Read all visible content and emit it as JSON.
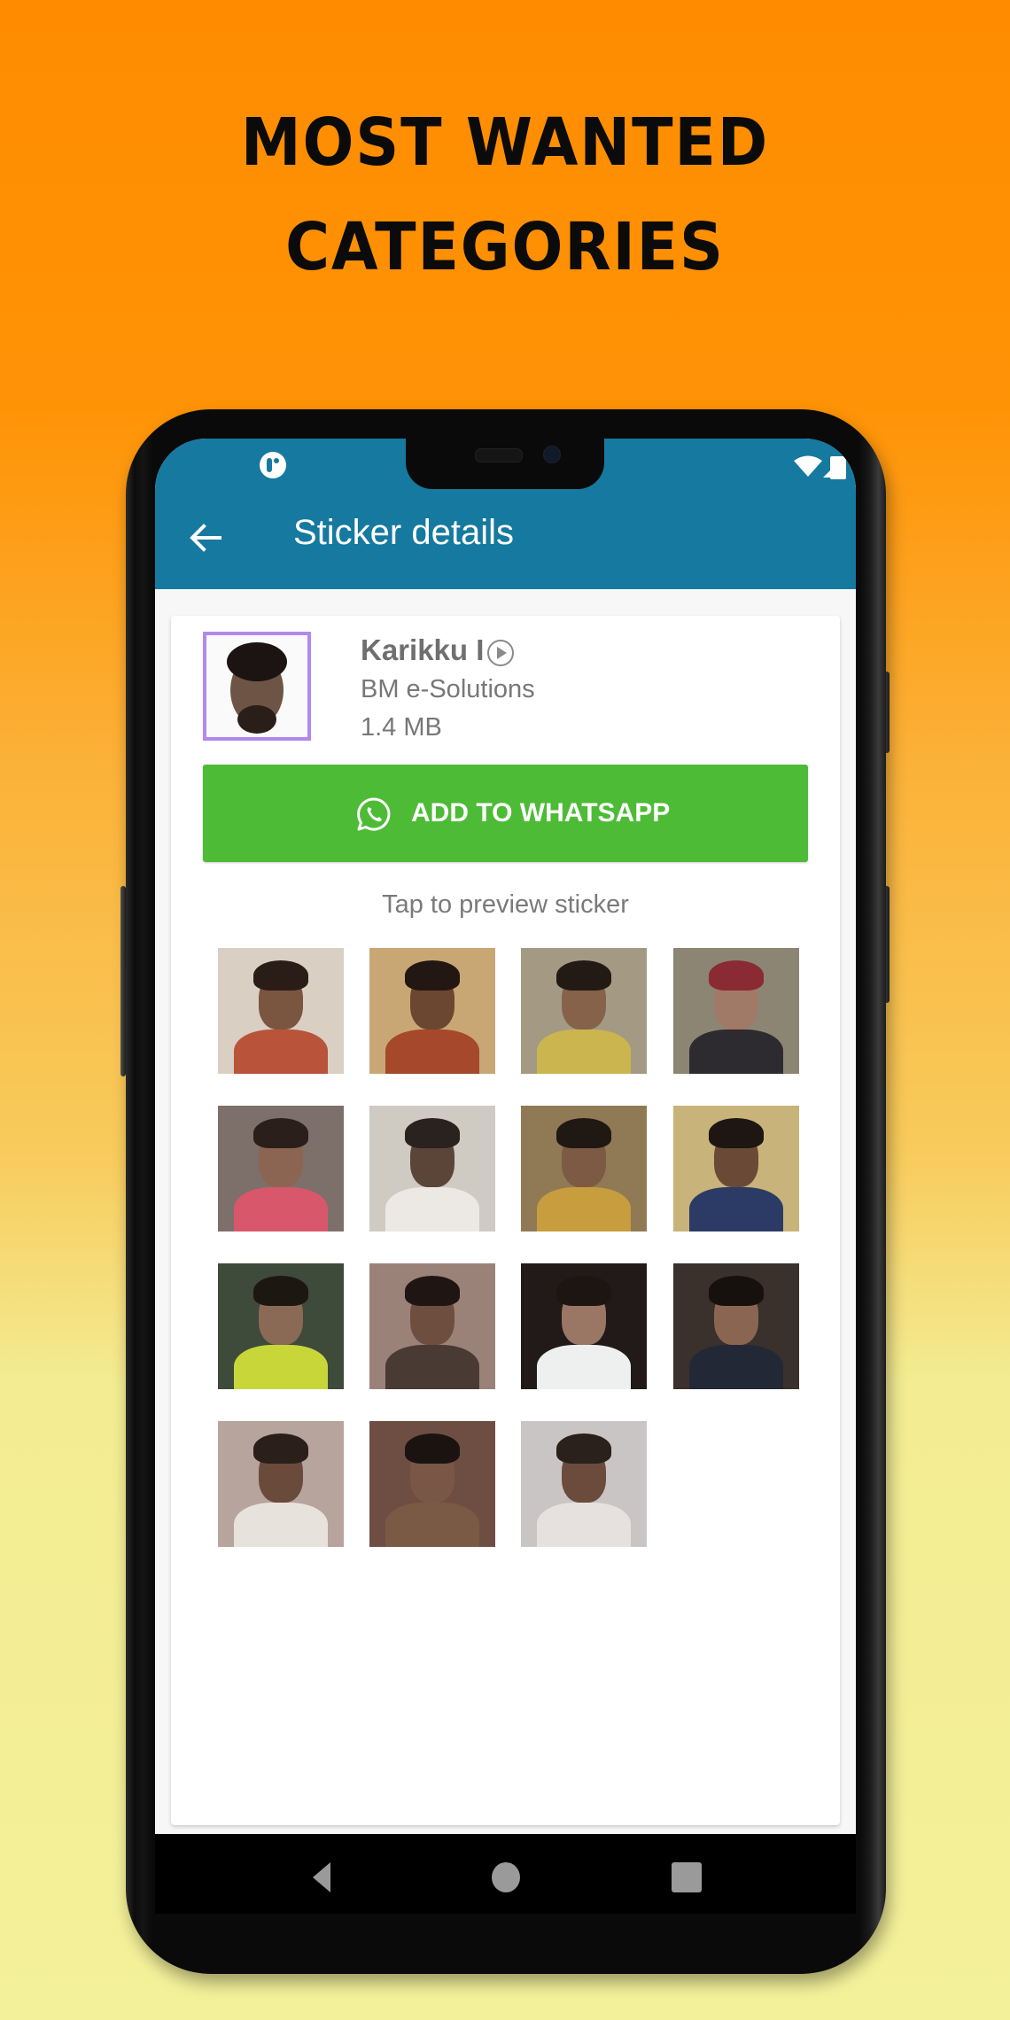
{
  "promo": {
    "headline_line1": "MOST WANTED",
    "headline_line2": "CATEGORIES",
    "background_top_color": "#FF8C00",
    "background_bottom_color": "#F3F19A"
  },
  "status_bar": {
    "left_icons": [
      "app-notification-icon"
    ],
    "right_icons": [
      "wifi-icon",
      "cellular-signal-icon",
      "battery-icon"
    ]
  },
  "app_bar": {
    "title": "Sticker details",
    "back_icon": "arrow-left-icon",
    "color": "#16799F"
  },
  "sticker_pack": {
    "name": "Karikku I",
    "name_icon": "play-circle-icon",
    "publisher": "BM e-Solutions",
    "size": "1.4 MB",
    "tray_border_color": "#B388EE"
  },
  "add_button": {
    "label": "ADD TO WHATSAPP",
    "icon": "whatsapp-icon",
    "color": "#4DBB36"
  },
  "preview_hint": "Tap to preview sticker",
  "stickers": [
    {
      "id": 1,
      "bg": "#d9cfc3",
      "shirt": "#b9533a",
      "skin": "#7a5540",
      "hair": "#2a1d17"
    },
    {
      "id": 2,
      "bg": "#c9a774",
      "shirt": "#a5482c",
      "skin": "#6b4630",
      "hair": "#221712"
    },
    {
      "id": 3,
      "bg": "#a49a83",
      "shirt": "#cbb54e",
      "skin": "#86624a",
      "hair": "#231a15"
    },
    {
      "id": 4,
      "bg": "#8c8573",
      "shirt": "#2e2b30",
      "skin": "#a07a66",
      "hair": "#8a2a33"
    },
    {
      "id": 5,
      "bg": "#7d6f6a",
      "shirt": "#d9576a",
      "skin": "#8c6552",
      "hair": "#2a1f1b"
    },
    {
      "id": 6,
      "bg": "#cfcac2",
      "shirt": "#ece9e4",
      "skin": "#5b4438",
      "hair": "#2a221e"
    },
    {
      "id": 7,
      "bg": "#8f7a55",
      "shirt": "#c89d3e",
      "skin": "#7c5a44",
      "hair": "#1f1813"
    },
    {
      "id": 8,
      "bg": "#c8b37a",
      "shirt": "#2c3b66",
      "skin": "#6a4a37",
      "hair": "#1d1612"
    },
    {
      "id": 9,
      "bg": "#3e4a3a",
      "shirt": "#c8d63a",
      "skin": "#8a6a55",
      "hair": "#1d1712"
    },
    {
      "id": 10,
      "bg": "#9b8278",
      "shirt": "#4a3a34",
      "skin": "#6e4e3e",
      "hair": "#1f1613"
    },
    {
      "id": 11,
      "bg": "#221a18",
      "shirt": "#eef0f0",
      "skin": "#9a7664",
      "hair": "#1d1512"
    },
    {
      "id": 12,
      "bg": "#3a302c",
      "shirt": "#232836",
      "skin": "#8a6652",
      "hair": "#17110e"
    },
    {
      "id": 13,
      "bg": "#b7a49c",
      "shirt": "#e8e2dc",
      "skin": "#6a4a3a",
      "hair": "#2a1f1a"
    },
    {
      "id": 14,
      "bg": "#6e4e42",
      "shirt": "#7a5a45",
      "skin": "#7a5646",
      "hair": "#1b1310"
    },
    {
      "id": 15,
      "bg": "#c9c5c4",
      "shirt": "#e6e1de",
      "skin": "#6a4b3c",
      "hair": "#2a211c"
    }
  ],
  "nav_bar": {
    "buttons": [
      "back",
      "home",
      "recents"
    ]
  }
}
